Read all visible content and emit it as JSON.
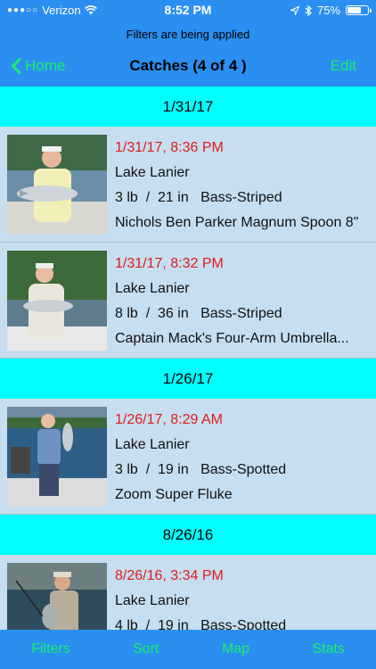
{
  "status_bar": {
    "carrier": "Verizon",
    "time": "8:52 PM",
    "battery": "75%",
    "battery_fraction": 0.75,
    "signal_icon": "signal-dots-icon",
    "wifi_icon": "wifi-icon",
    "location_icon": "location-arrow-icon",
    "bluetooth_icon": "bluetooth-icon"
  },
  "nav": {
    "filter_notice": "Filters are being applied",
    "back_label": "Home",
    "title": "Catches (4 of 4 )",
    "edit_label": "Edit"
  },
  "sections": [
    {
      "header": "1/31/17",
      "rows": [
        {
          "datetime": "1/31/17, 8:36 PM",
          "location": "Lake Lanier",
          "weight": "3 lb",
          "length": "21 in",
          "species": "Bass-Striped",
          "lure": "Nichols Ben Parker Magnum Spoon 8\""
        },
        {
          "datetime": "1/31/17, 8:32 PM",
          "location": "Lake Lanier",
          "weight": "8 lb",
          "length": "36 in",
          "species": "Bass-Striped",
          "lure": "Captain Mack's Four-Arm Umbrella..."
        }
      ]
    },
    {
      "header": "1/26/17",
      "rows": [
        {
          "datetime": "1/26/17, 8:29 AM",
          "location": "Lake Lanier",
          "weight": "3 lb",
          "length": "19 in",
          "species": "Bass-Spotted",
          "lure": "Zoom Super Fluke"
        }
      ]
    },
    {
      "header": "8/26/16",
      "rows": [
        {
          "datetime": "8/26/16, 3:34 PM",
          "location": "Lake Lanier",
          "weight": "4 lb",
          "length": "19 in",
          "species": "Bass-Spotted",
          "lure": ""
        }
      ]
    }
  ],
  "separator": "/",
  "tabs": [
    "Filters",
    "Sort",
    "Map",
    "Stats"
  ],
  "colors": {
    "bar_blue": "#2a8ff0",
    "accent_green": "#18f06a",
    "section_cyan": "#00ffff",
    "row_bg": "#c6def0",
    "datetime_red": "#e21b1b"
  }
}
